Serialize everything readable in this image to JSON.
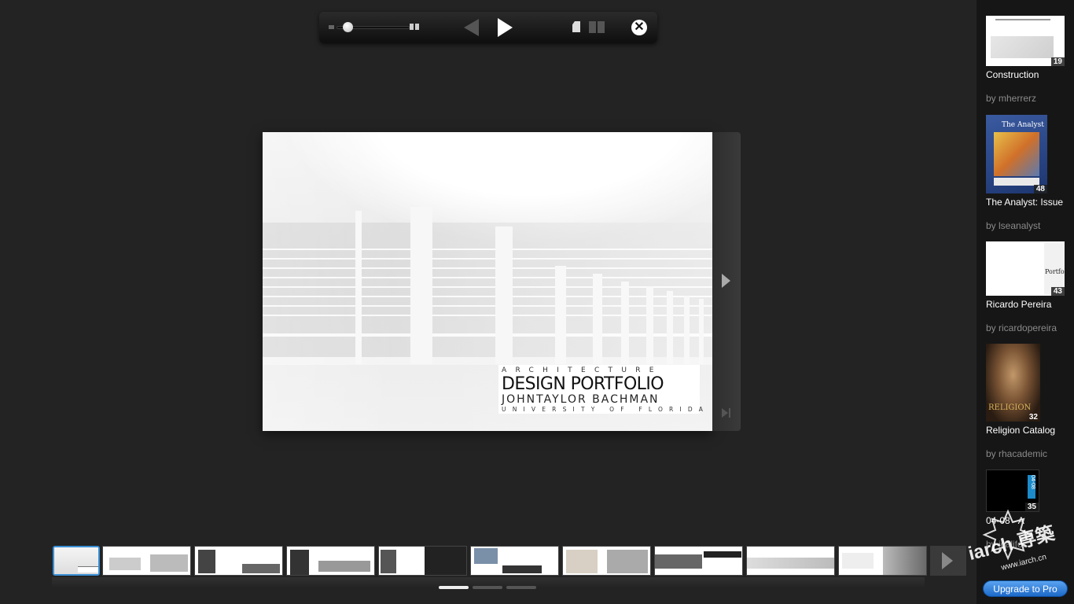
{
  "toolbar": {
    "zoom_level": 0.1
  },
  "page": {
    "title_line1": "ARCHITECTURE",
    "title_line2": "DESIGN PORTFOLIO",
    "title_line3": "JOHNTAYLOR BACHMAN",
    "title_line4": "UNIVERSITY OF FLORIDA"
  },
  "strip": {
    "pages_total": 3,
    "page_current": 1
  },
  "sidebar": {
    "recommendations": [
      {
        "title": "Construction",
        "count": "19",
        "author": "by mherrerz"
      },
      {
        "title": "The Analyst: Issue",
        "count": "48",
        "author": "by lseanalyst",
        "cover_heading": "The Analyst"
      },
      {
        "title": "Ricardo Pereira",
        "count": "43",
        "author": "by ricardopereira",
        "cover_heading": "Portfolio"
      },
      {
        "title": "Religion Catalog",
        "count": "32",
        "author": "by rhacademic",
        "cover_heading": "RELIGION"
      },
      {
        "title": "04-08 - A",
        "count": "35",
        "author": "by icalifo...",
        "cover_heading": "04-08"
      }
    ],
    "upgrade_label": "Upgrade to Pro"
  },
  "watermark": {
    "text": "iarch 専築",
    "url": "www.iarch.cn"
  }
}
